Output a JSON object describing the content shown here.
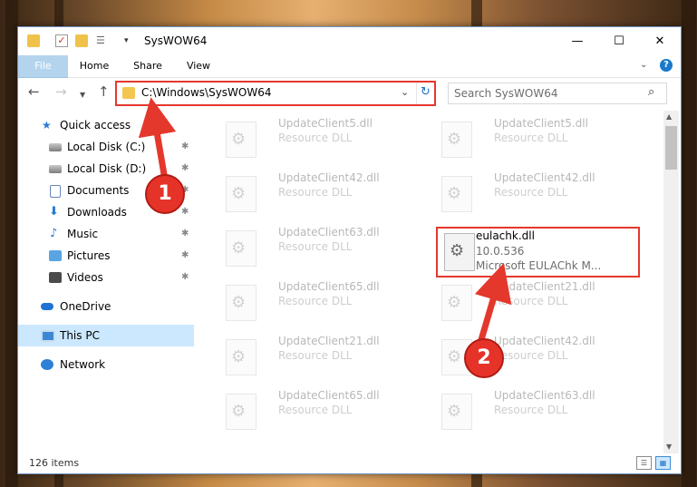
{
  "window": {
    "title": "SysWOW64",
    "controls": {
      "minimize": "—",
      "maximize": "☐",
      "close": "✕"
    }
  },
  "ribbon": {
    "tabs": [
      "File",
      "Home",
      "Share",
      "View"
    ],
    "help_label": "?"
  },
  "address": {
    "path": "C:\\Windows\\SysWOW64",
    "search_placeholder": "Search SysWOW64"
  },
  "nav_pane": {
    "items": [
      {
        "label": "Quick access",
        "icon": "star-icon"
      },
      {
        "label": "Local Disk (C:)",
        "icon": "disk-icon",
        "pinned": true
      },
      {
        "label": "Local Disk (D:)",
        "icon": "disk-icon",
        "pinned": true
      },
      {
        "label": "Documents",
        "icon": "document-icon",
        "pinned": true
      },
      {
        "label": "Downloads",
        "icon": "download-icon",
        "pinned": true
      },
      {
        "label": "Music",
        "icon": "music-icon",
        "pinned": true
      },
      {
        "label": "Pictures",
        "icon": "pictures-icon",
        "pinned": true
      },
      {
        "label": "Videos",
        "icon": "videos-icon",
        "pinned": true
      },
      {
        "label": "OneDrive",
        "icon": "cloud-icon"
      },
      {
        "label": "This PC",
        "icon": "pc-icon",
        "selected": true
      },
      {
        "label": "Network",
        "icon": "network-icon"
      }
    ]
  },
  "files": {
    "items": [
      {
        "name": "UpdateClient5.dll",
        "type": "Resource DLL"
      },
      {
        "name": "UpdateClient5.dll",
        "type": "Resource DLL"
      },
      {
        "name": "UpdateClient42.dll",
        "type": "Resource DLL"
      },
      {
        "name": "UpdateClient42.dll",
        "type": "Resource DLL"
      },
      {
        "name": "UpdateClient63.dll",
        "type": "Resource DLL"
      },
      {
        "name": "UpdateClient65.dll",
        "type": "Resource DLL"
      },
      {
        "name": "UpdateClient21.dll",
        "type": "Resource DLL"
      },
      {
        "name": "UpdateClient21.dll",
        "type": "Resource DLL"
      },
      {
        "name": "UpdateClient42.dll",
        "type": "Resource DLL"
      },
      {
        "name": "UpdateClient65.dll",
        "type": "Resource DLL"
      },
      {
        "name": "UpdateClient63.dll",
        "type": "Resource DLL"
      }
    ],
    "highlighted": {
      "name": "eulachk.dll",
      "version": "10.0.536",
      "description": "Microsoft EULAChk M..."
    }
  },
  "status": {
    "item_count": "126 items"
  },
  "annotations": {
    "step1": "1",
    "step2": "2",
    "color": "#e4382d"
  }
}
